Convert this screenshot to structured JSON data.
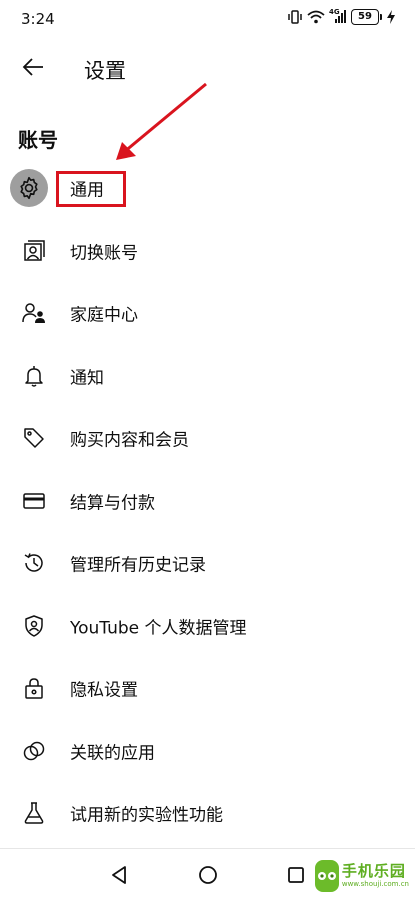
{
  "status_bar": {
    "time": "3:24",
    "signal_label": "4G",
    "battery_level": "59"
  },
  "header": {
    "title": "设置"
  },
  "section": {
    "title": "账号"
  },
  "items": [
    {
      "label": "通用",
      "icon": "gear-icon"
    },
    {
      "label": "切换账号",
      "icon": "switch-account-icon"
    },
    {
      "label": "家庭中心",
      "icon": "family-icon"
    },
    {
      "label": "通知",
      "icon": "bell-icon"
    },
    {
      "label": "购买内容和会员",
      "icon": "tag-icon"
    },
    {
      "label": "结算与付款",
      "icon": "credit-card-icon"
    },
    {
      "label": "管理所有历史记录",
      "icon": "history-icon"
    },
    {
      "label": "YouTube 个人数据管理",
      "icon": "shield-person-icon"
    },
    {
      "label": "隐私设置",
      "icon": "lock-icon"
    },
    {
      "label": "关联的应用",
      "icon": "linked-apps-icon"
    },
    {
      "label": "试用新的实验性功能",
      "icon": "flask-icon"
    }
  ],
  "watermark": {
    "title": "手机乐园",
    "subtitle": "www.shouji.com.cn"
  },
  "colors": {
    "highlight_box": "#d9141e",
    "arrow": "#d9141e",
    "text": "#0f0f0f"
  }
}
